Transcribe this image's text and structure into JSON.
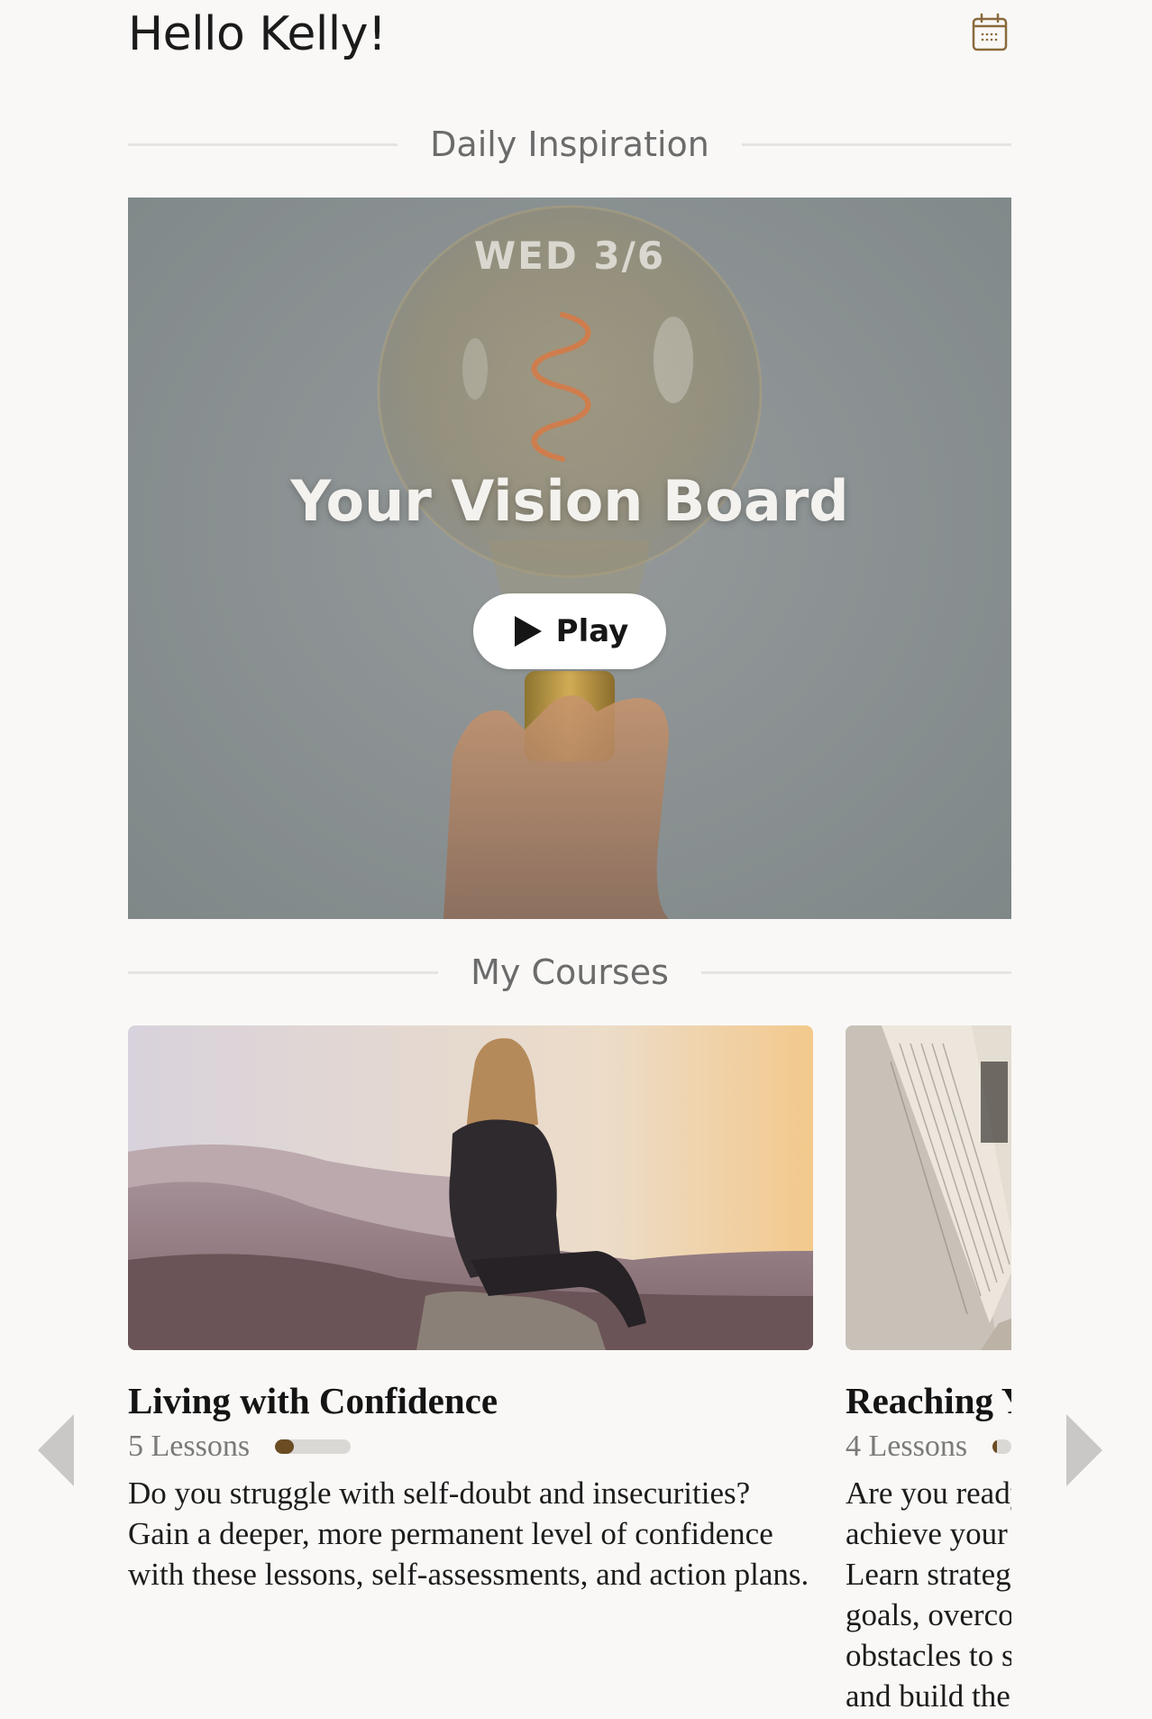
{
  "header": {
    "greeting": "Hello Kelly!",
    "calendar_icon": "calendar-icon",
    "accent_color": "#8a6a3c"
  },
  "daily_inspiration": {
    "section_title": "Daily Inspiration",
    "date": "WED 3/6",
    "title": "Your Vision Board",
    "play_label": "Play",
    "play_icon": "play-icon"
  },
  "courses": {
    "section_title": "My Courses",
    "items": [
      {
        "title": "Living with Confidence",
        "lessons": "5 Lessons",
        "progress": 0.25,
        "description": "Do you struggle with self-doubt and insecurities? Gain a deeper, more permanent level of confidence with these lessons, self-assessments, and action plans."
      },
      {
        "title": "Reaching Your Goals",
        "lessons": "4 Lessons",
        "progress": 0.25,
        "description": "Are you ready to achieve your goals? Learn strategies to set goals, overcome obstacles to success, and build the path that leads to victory."
      }
    ],
    "prev_icon": "chevron-left-icon",
    "next_icon": "chevron-right-icon"
  }
}
